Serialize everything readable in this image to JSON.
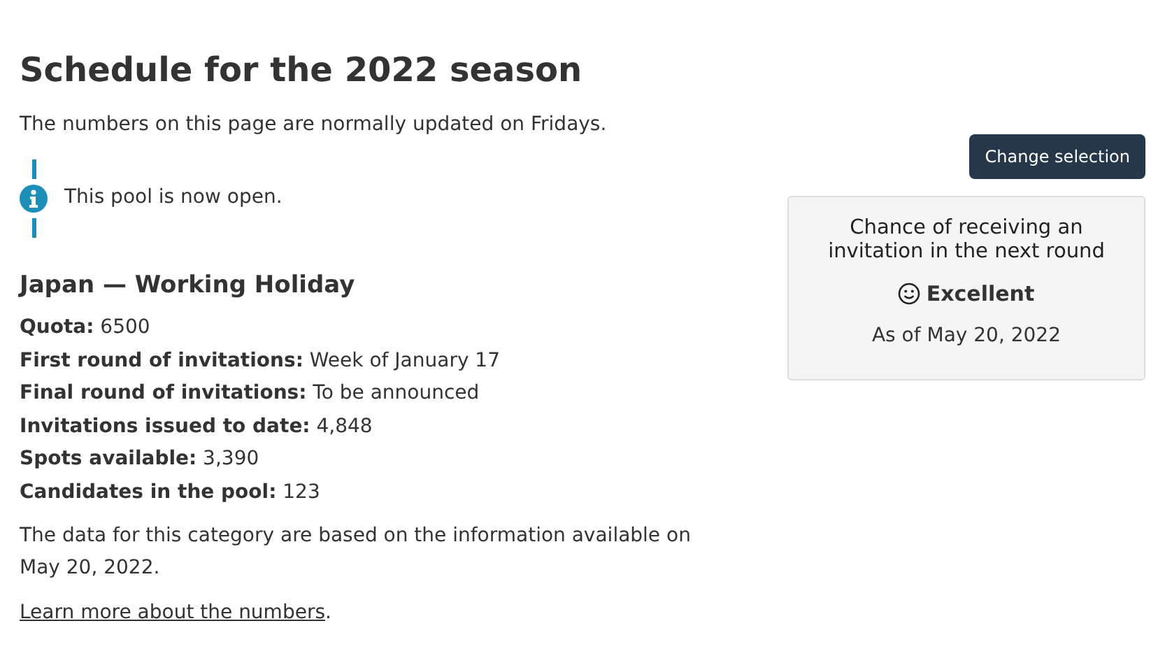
{
  "title": "Schedule for the 2022 season",
  "intro": "The numbers on this page are normally updated on Fridays.",
  "alert": {
    "text": "This pool is now open."
  },
  "category": "Japan — Working Holiday",
  "facts": [
    "**Quota:** 6500",
    "**First round of invitations:** Week of January 17",
    "**Final round of invitations:** To be announced",
    "**Invitations issued to date:** 4,848",
    "**Spots available:** 3,390",
    "**Candidates in the pool:** 123"
  ],
  "note": "The data for this category are based on the information available on May 20, 2022.",
  "link": {
    "text": "Learn more about the numbers",
    "after": "."
  },
  "button": "Change selection",
  "chance": {
    "heading": "Chance of receiving an invitation in the next round",
    "rating": "Excellent",
    "date": "As of May 20, 2022"
  }
}
